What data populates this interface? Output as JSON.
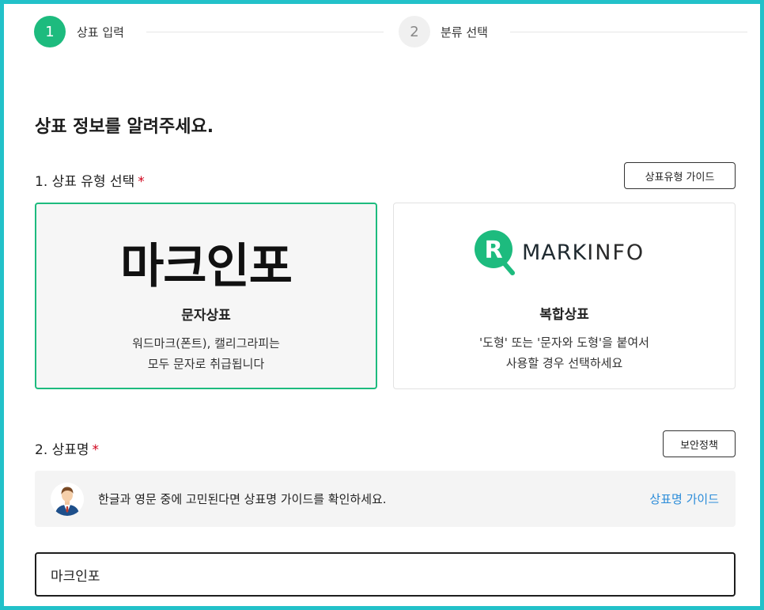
{
  "stepper": {
    "steps": [
      {
        "number": "1",
        "label": "상표 입력",
        "active": true
      },
      {
        "number": "2",
        "label": "분류 선택",
        "active": false
      }
    ]
  },
  "page_title": "상표 정보를 알려주세요.",
  "section1": {
    "label": "1. 상표 유형 선택",
    "required_mark": "*",
    "guide_button": "상표유형 가이드",
    "cards": [
      {
        "preview_text": "마크인포",
        "title": "문자상표",
        "desc_line1": "워드마크(폰트), 캘리그라피는",
        "desc_line2": "모두 문자로 취급됩니다",
        "selected": true
      },
      {
        "logo_letter": "R",
        "logo_bold": "MARK",
        "logo_thin": "INFO",
        "title": "복합상표",
        "desc_line1": "'도형' 또는 '문자와 도형'을 붙여서",
        "desc_line2": "사용할 경우 선택하세요",
        "selected": false
      }
    ]
  },
  "section2": {
    "label": "2. 상표명",
    "required_mark": "*",
    "security_button": "보안정책",
    "guide": {
      "text": "한글과 영문 중에 고민된다면 상표명 가이드를 확인하세요.",
      "link": "상표명 가이드"
    },
    "input_value": "마크인포"
  },
  "colors": {
    "accent_green": "#1dbb7e",
    "link_blue": "#2b8cd9",
    "required_red": "#d0021b",
    "frame_teal": "#22c1c9"
  }
}
